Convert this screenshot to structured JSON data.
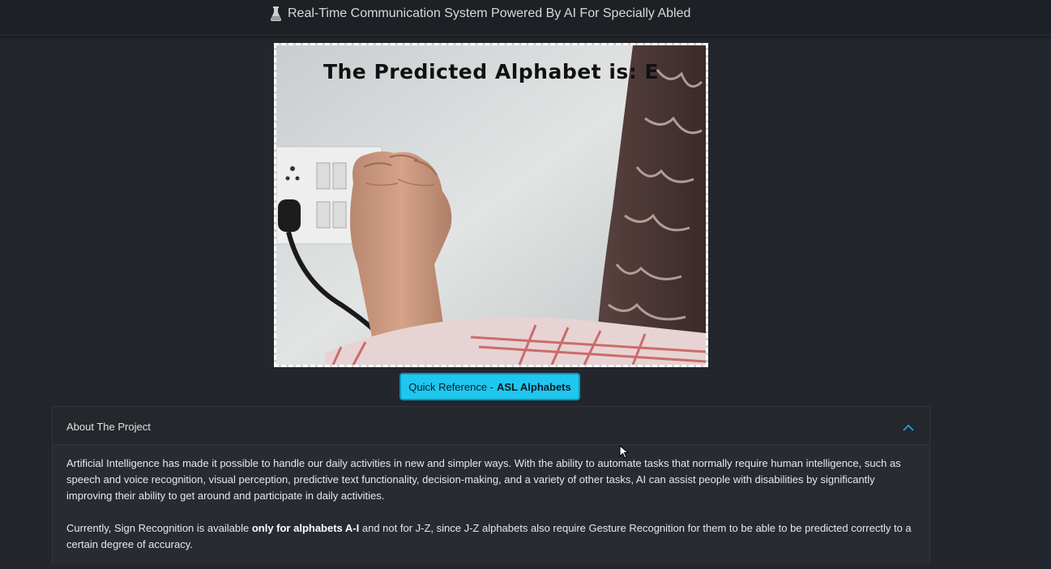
{
  "header": {
    "title": "Real-Time Communication System Powered By AI For Specially Abled",
    "icon": "flask-icon"
  },
  "video": {
    "prediction_text": "The Predicted Alphabet is: E"
  },
  "quick_reference": {
    "label_prefix": "Quick Reference - ",
    "label_bold": "ASL Alphabets"
  },
  "about": {
    "title": "About The Project",
    "expanded": true,
    "paragraph1": "Artificial Intelligence has made it possible to handle our daily activities in new and simpler ways. With the ability to automate tasks that normally require human intelligence, such as speech and voice recognition, visual perception, predictive text functionality, decision-making, and a variety of other tasks, AI can assist people with disabilities by significantly improving their ability to get around and participate in daily activities.",
    "paragraph2_before": "Currently, Sign Recognition is available ",
    "paragraph2_bold": "only for alphabets A-I",
    "paragraph2_after": " and not for J-Z, since J-Z alphabets also require Gesture Recognition for them to be able to be predicted correctly to a certain degree of accuracy."
  },
  "colors": {
    "background": "#23262d",
    "topbar": "#1d2024",
    "accent": "#1fc7ef",
    "chevron": "#1fa3e0"
  }
}
